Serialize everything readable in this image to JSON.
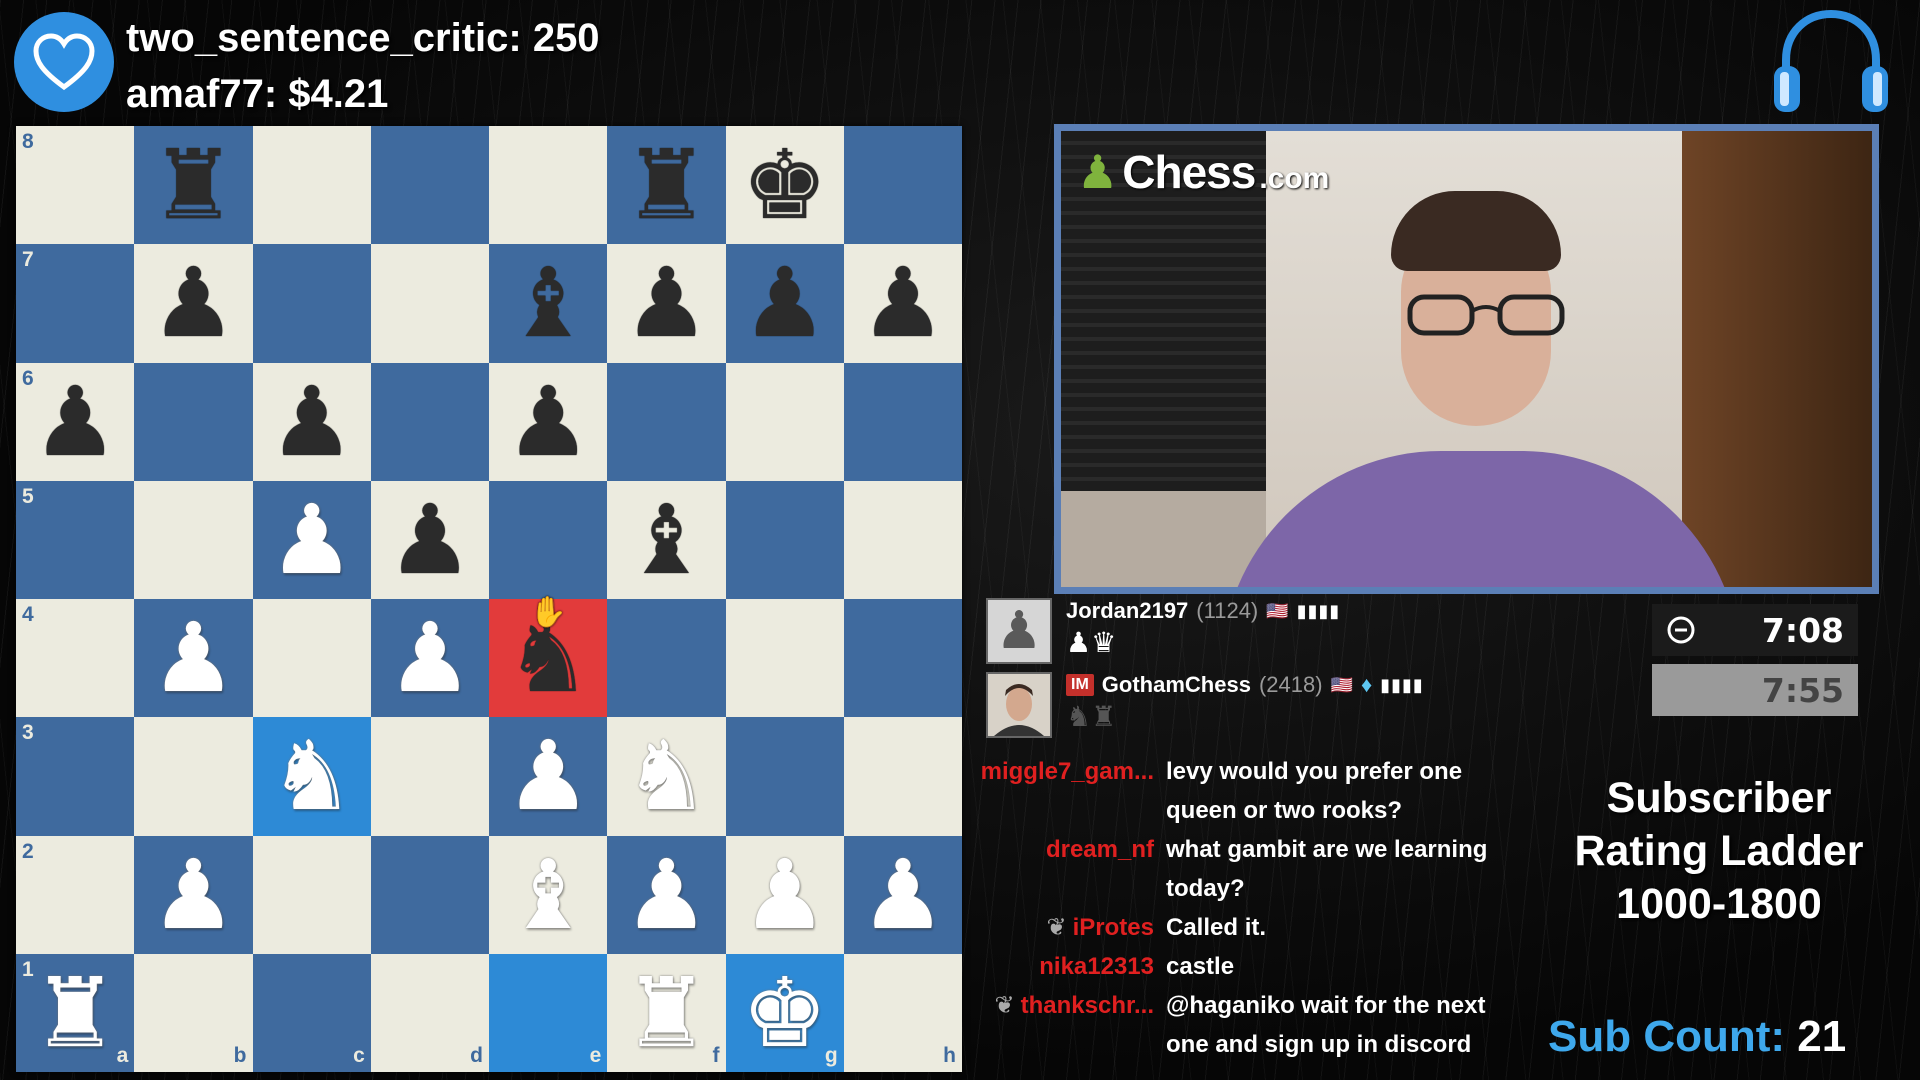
{
  "alerts": {
    "top_cheer": "two_sentence_critic: 250",
    "top_tip": "amaf77: $4.21"
  },
  "webcam": {
    "logo_brand": "Chess",
    "logo_tld": ".com"
  },
  "board": {
    "ranks": [
      "8",
      "7",
      "6",
      "5",
      "4",
      "3",
      "2",
      "1"
    ],
    "files": [
      "a",
      "b",
      "c",
      "d",
      "e",
      "f",
      "g",
      "h"
    ],
    "rows": [
      [
        "",
        "r",
        "",
        "",
        "",
        "r",
        "k",
        ""
      ],
      [
        "",
        "p",
        "",
        "",
        "b",
        "p",
        "p",
        "p"
      ],
      [
        "p",
        "",
        "p",
        "",
        "p",
        "",
        "",
        ""
      ],
      [
        "",
        "",
        "P",
        "p",
        "",
        "b",
        "",
        ""
      ],
      [
        "",
        "P",
        "",
        "P",
        "n",
        "",
        "",
        ""
      ],
      [
        "",
        "",
        "N",
        "",
        "P",
        "N",
        "",
        ""
      ],
      [
        "",
        "P",
        "",
        "",
        "B",
        "P",
        "P",
        "P"
      ],
      [
        "R",
        "",
        "",
        "",
        "",
        "R",
        "K",
        ""
      ]
    ],
    "highlights": {
      "blue": [
        "c3",
        "e1",
        "g1"
      ],
      "red": [
        "e4"
      ]
    }
  },
  "players": {
    "top": {
      "name": "Jordan2197",
      "rating": "(1124)",
      "flag": "🇺🇸",
      "bars": "▮▮▮▮",
      "captured": "♟♛"
    },
    "bottom": {
      "title": "IM",
      "name": "GothamChess",
      "rating": "(2418)",
      "flag": "🇺🇸",
      "diamond": "♦",
      "bars": "▮▮▮▮",
      "captured": "♞♜"
    }
  },
  "clocks": {
    "top": "7:08",
    "bottom": "7:55"
  },
  "chat": [
    {
      "user": "miggle7_gam...",
      "badge": "",
      "text": "levy would you prefer one queen or two rooks?"
    },
    {
      "user": "dream_nf",
      "badge": "",
      "text": "what gambit are we learning today?"
    },
    {
      "user": "iProtes",
      "badge": "❦",
      "text": "Called it."
    },
    {
      "user": "nika12313",
      "badge": "",
      "text": "castle"
    },
    {
      "user": "thankschr...",
      "badge": "❦",
      "text": "@haganiko wait for the next one and sign up in discord"
    }
  ],
  "ladder": {
    "line1": "Subscriber",
    "line2": "Rating Ladder",
    "line3": "1000-1800"
  },
  "subcount": {
    "label": "Sub Count:",
    "value": "21"
  },
  "icons": {
    "heart": "heart-icon",
    "headset": "headphones-icon",
    "clock": "clock-icon"
  },
  "colors": {
    "board_light": "#ecebdf",
    "board_dark": "#3f6a9e",
    "highlight_blue": "#2d8ad6",
    "highlight_red": "#e23b3b",
    "accent_blue": "#3ea8ec",
    "chat_user": "#e02020"
  }
}
